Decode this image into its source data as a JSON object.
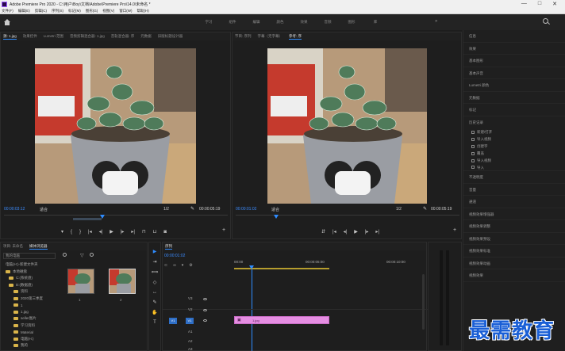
{
  "window": {
    "title": "Adobe Premiere Pro 2020 - C:\\用户\\Boy\\文档\\Adobe\\Premiere Pro\\14.0\\未命名 *",
    "controls": [
      "—",
      "□",
      "✕"
    ]
  },
  "menubar": [
    "文件(F)",
    "编辑(E)",
    "剪辑(C)",
    "序列(S)",
    "标记(M)",
    "图形(G)",
    "视图(V)",
    "窗口(W)",
    "帮助(H)"
  ],
  "workspace": {
    "tabs": [
      "学习",
      "组件",
      "编辑",
      "颜色",
      "效果",
      "音频",
      "图形",
      "库"
    ],
    "more": "»"
  },
  "source_monitor": {
    "tabs": [
      "源: 1.jpg",
      "效果控件",
      "Lumetri 范围",
      "音频剪辑混合器: 1.jpg",
      "音轨混合器: 序",
      "元数据",
      "旧版标题设计器"
    ],
    "timecode_left": "00:00:03:12",
    "fit_label": "适合",
    "scale_label": "1/2",
    "timecode_right": "00:00:05:19"
  },
  "program_monitor": {
    "tabs": [
      "节目: 序列",
      "字幕（无字幕）",
      "参考: 序"
    ],
    "timecode_left": "00:00:01:02",
    "fit_label": "适合",
    "scale_label": "1/2",
    "timecode_right": "00:00:05:19"
  },
  "effects_panel": {
    "items": [
      "信息",
      "效果",
      "基本图形",
      "基本声音",
      "Lumetri 颜色",
      "元数据",
      "标记",
      "历史记录"
    ],
    "history": [
      "新建/打开",
      "导入视频",
      "创建字",
      "覆盖",
      "导入视频",
      "导入"
    ],
    "sections": [
      "不透明度",
      "音量",
      "通道",
      "视频效果增强器",
      "视频效果调整",
      "视频效果预设",
      "视频效果标准",
      "视频效果动画",
      "视频效果"
    ]
  },
  "project_panel": {
    "tabs": [
      "项目: 未命名",
      "媒体浏览器"
    ],
    "search_label": "我的电脑",
    "rows": [
      "电脑(H:)-新建文件夹",
      "本地磁盘",
      "C:(系统盘)",
      "D:(数据盘)",
      "资料",
      "2020第三季度",
      "1",
      "1.jpg",
      "seller图片",
      "学习资料",
      "Material",
      "电脑(H:)",
      "我的"
    ],
    "thumb_labels": [
      "1",
      "2"
    ]
  },
  "timeline": {
    "timecode": "00:00:01:02",
    "ruler": [
      "00:00",
      "00:00:05:00",
      "00:00:10:00"
    ],
    "tracks": [
      "V3",
      "V2",
      "V1",
      "A1",
      "A2",
      "A3"
    ],
    "clip_label": "1.jpg"
  },
  "watermark": "最需教育",
  "colors": {
    "accent": "#2f8cff",
    "clip": "#e58ee2",
    "watermark": "#1a5fd6"
  }
}
